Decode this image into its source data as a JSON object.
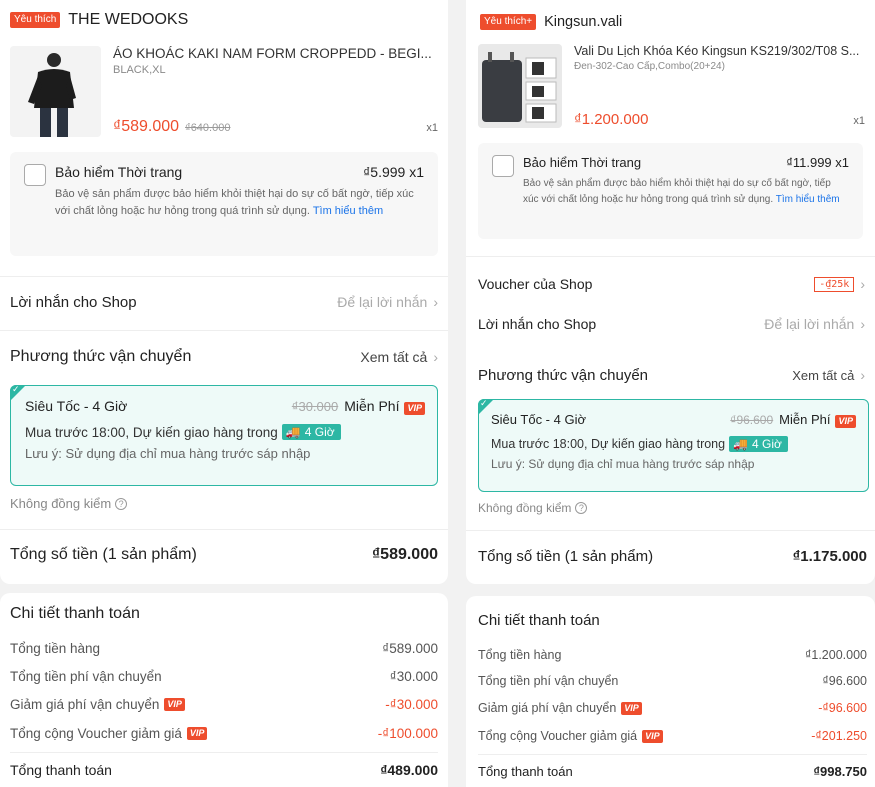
{
  "left": {
    "shop_badge": "Yêu thích",
    "shop_name": "THE WEDOOKS",
    "product": {
      "title": "ÁO KHOÁC KAKI NAM FORM CROPPEDD - BEGI...",
      "variant": "BLACK,XL",
      "price": "₫589.000",
      "old_price": "₫640.000",
      "qty": "x1"
    },
    "insurance": {
      "title": "Bảo hiểm Thời trang",
      "price": "₫5.999  x1",
      "desc": "Bảo vệ sản phẩm được bảo hiểm khỏi thiệt hại do sự cố bất ngờ, tiếp xúc với chất lỏng hoặc hư hỏng trong quá trình sử dụng.",
      "link": "Tìm hiểu thêm"
    },
    "message": {
      "label": "Lời nhắn cho Shop",
      "placeholder": "Để lại lời nhắn"
    },
    "shipping": {
      "label": "Phương thức vận chuyển",
      "see_all": "Xem tất cả",
      "name": "Siêu Tốc - 4 Giờ",
      "old_fee": "₫30.000",
      "fee": "Miễn Phí",
      "line": "Mua trước 18:00, Dự kiến giao hàng trong",
      "chip": "4 Giờ",
      "note": "Lưu ý: Sử dụng địa chỉ mua hàng trước sáp nhập"
    },
    "no_check": "Không đồng kiểm",
    "total_label": "Tổng số tiền (1 sản phẩm)",
    "total_value": "₫589.000",
    "payment": {
      "title": "Chi tiết thanh toán",
      "rows": [
        {
          "label": "Tổng tiền hàng",
          "value": "₫589.000"
        },
        {
          "label": "Tổng tiền phí vận chuyển",
          "value": "₫30.000"
        },
        {
          "label": "Giảm giá phí vận chuyển",
          "value": "-₫30.000"
        },
        {
          "label": "Tổng cộng Voucher giảm giá",
          "value": "-₫100.000"
        }
      ],
      "total_label": "Tổng thanh toán",
      "total_value": "₫489.000"
    }
  },
  "right": {
    "shop_badge": "Yêu thích+",
    "shop_name": "Kingsun.vali",
    "product": {
      "title": "Vali Du Lịch Khóa Kéo Kingsun KS219/302/T08 S...",
      "variant": "Đen-302-Cao Cấp,Combo(20+24)",
      "price": "₫1.200.000",
      "qty": "x1"
    },
    "insurance": {
      "title": "Bảo hiểm Thời trang",
      "price": "₫11.999  x1",
      "desc": "Bảo vệ sản phẩm được bảo hiểm khỏi thiệt hại do sự cố bất ngờ, tiếp xúc với chất lỏng hoặc hư hỏng trong quá trình sử dụng.",
      "link": "Tìm hiểu thêm"
    },
    "voucher": {
      "label": "Voucher của Shop",
      "tag": "-₫25k"
    },
    "message": {
      "label": "Lời nhắn cho Shop",
      "placeholder": "Để lại lời nhắn"
    },
    "shipping": {
      "label": "Phương thức vận chuyển",
      "see_all": "Xem tất cả",
      "name": "Siêu Tốc - 4 Giờ",
      "old_fee": "₫96.600",
      "fee": "Miễn Phí",
      "line": "Mua trước 18:00, Dự kiến giao hàng trong",
      "chip": "4 Giờ",
      "note": "Lưu ý: Sử dụng địa chỉ mua hàng trước sáp nhập"
    },
    "no_check": "Không đồng kiểm",
    "total_label": "Tổng số tiền (1 sản phẩm)",
    "total_value": "₫1.175.000",
    "payment": {
      "title": "Chi tiết thanh toán",
      "rows": [
        {
          "label": "Tổng tiền hàng",
          "value": "₫1.200.000"
        },
        {
          "label": "Tổng tiền phí vận chuyển",
          "value": "₫96.600"
        },
        {
          "label": "Giảm giá phí vận chuyển",
          "value": "-₫96.600"
        },
        {
          "label": "Tổng cộng Voucher giảm giá",
          "value": "-₫201.250"
        }
      ],
      "total_label": "Tổng thanh toán",
      "total_value": "₫998.750"
    }
  },
  "vip_label": "VIP",
  "colors": {
    "accent": "#ee4d2d",
    "ship": "#2db7a4",
    "link": "#1a73e8"
  }
}
